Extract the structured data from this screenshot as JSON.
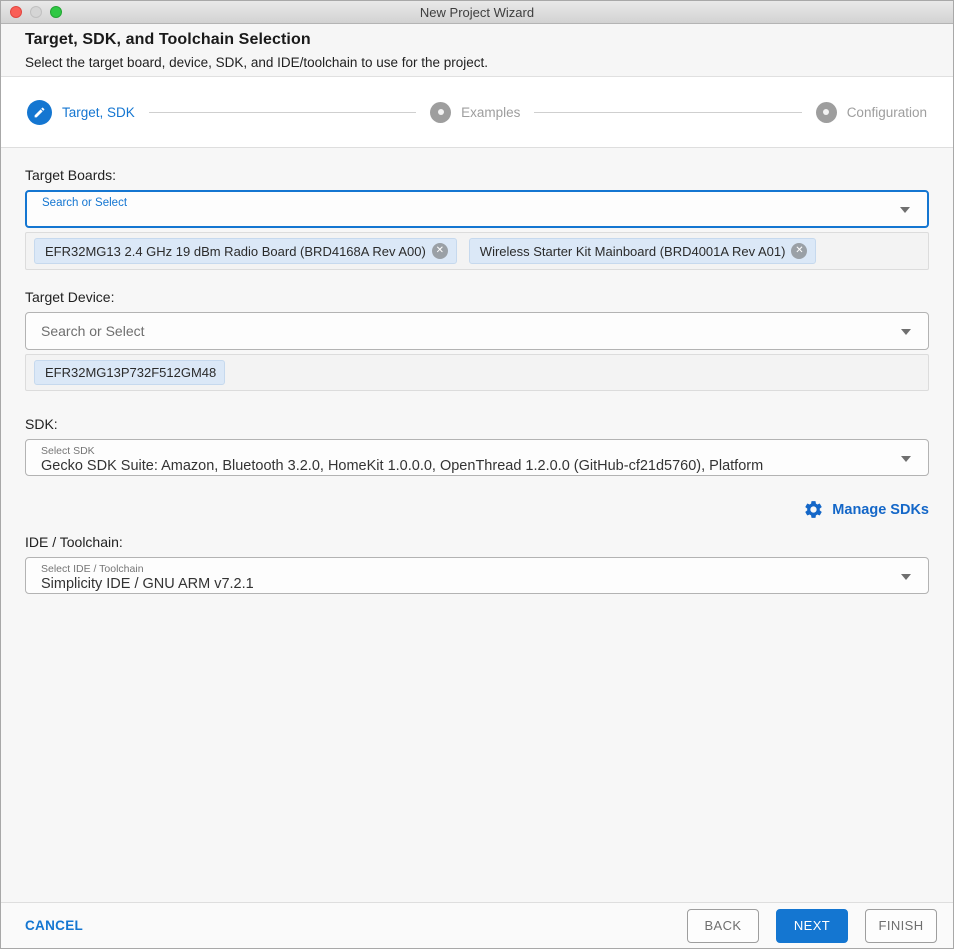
{
  "window": {
    "title": "New Project Wizard"
  },
  "header": {
    "title": "Target, SDK, and Toolchain Selection",
    "subtitle": "Select the target board, device, SDK, and IDE/toolchain to use for the project."
  },
  "stepper": {
    "steps": [
      {
        "label": "Target, SDK",
        "state": "active",
        "icon": "pencil-icon"
      },
      {
        "label": "Examples",
        "state": "pending",
        "icon": "dot-icon"
      },
      {
        "label": "Configuration",
        "state": "pending",
        "icon": "dot-icon"
      }
    ]
  },
  "form": {
    "target_boards": {
      "label": "Target Boards:",
      "placeholder": "Search or Select",
      "chips": [
        {
          "text": "EFR32MG13 2.4 GHz 19 dBm Radio Board (BRD4168A Rev A00)",
          "removable": true
        },
        {
          "text": "Wireless Starter Kit Mainboard (BRD4001A Rev A01)",
          "removable": true
        }
      ]
    },
    "target_device": {
      "label": "Target Device:",
      "placeholder": "Search or Select",
      "chips": [
        {
          "text": "EFR32MG13P732F512GM48",
          "removable": false
        }
      ]
    },
    "sdk": {
      "label": "SDK:",
      "select_label": "Select SDK",
      "value": "Gecko SDK Suite: Amazon, Bluetooth 3.2.0, HomeKit 1.0.0.0, OpenThread 1.2.0.0 (GitHub-cf21d5760), Platform",
      "manage_label": "Manage SDKs"
    },
    "ide_toolchain": {
      "label": "IDE / Toolchain:",
      "select_label": "Select IDE / Toolchain",
      "value": "Simplicity IDE / GNU ARM v7.2.1"
    }
  },
  "footer": {
    "cancel": "CANCEL",
    "back": "BACK",
    "next": "NEXT",
    "finish": "FINISH"
  },
  "icons": {
    "chip_close": "✕"
  },
  "colors": {
    "accent_blue": "#1476d1",
    "manage_blue": "#1467c8",
    "step_inactive_gray": "#9e9e9e",
    "chip_bg": "#dbe8f7",
    "traffic_red": "#f95f57",
    "traffic_gray": "#d5d5d5",
    "traffic_green": "#30c844"
  }
}
